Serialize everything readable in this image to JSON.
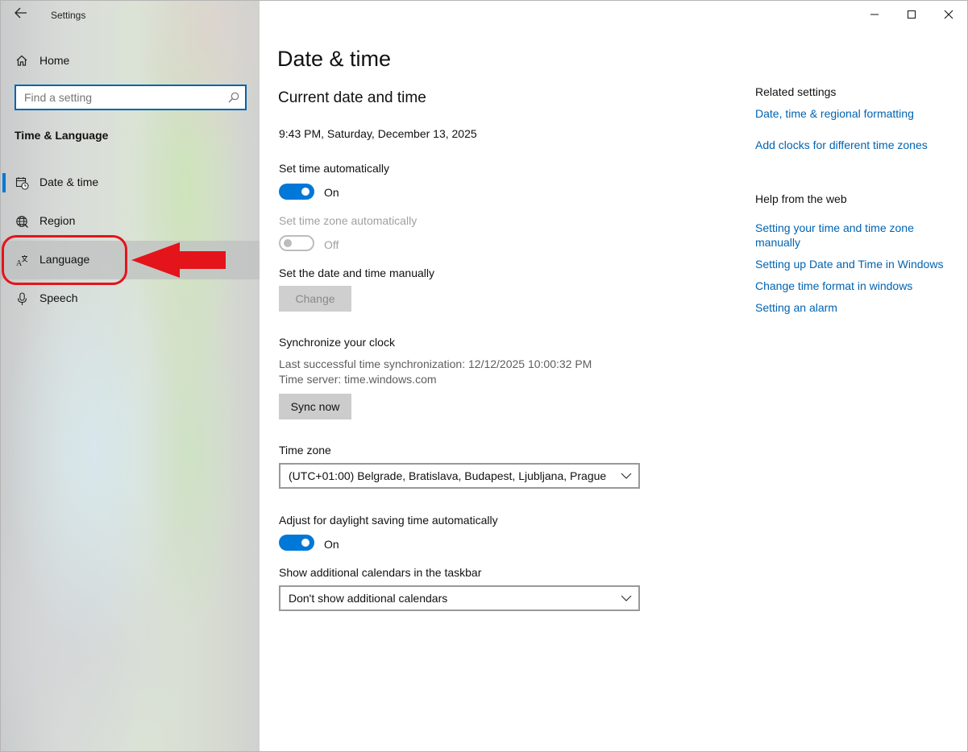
{
  "window": {
    "app_title": "Settings",
    "controls": [
      "minimize-icon",
      "maximize-icon",
      "close-icon"
    ]
  },
  "sidebar": {
    "home_label": "Home",
    "search_placeholder": "Find a setting",
    "section_title": "Time & Language",
    "items": [
      {
        "label": "Date & time",
        "icon": "date-time-icon",
        "selected": true
      },
      {
        "label": "Region",
        "icon": "globe-icon",
        "selected": false
      },
      {
        "label": "Language",
        "icon": "language-icon",
        "selected": false,
        "hovered": true
      },
      {
        "label": "Speech",
        "icon": "microphone-icon",
        "selected": false
      }
    ]
  },
  "main": {
    "page_title": "Date & time",
    "section_title": "Current date and time",
    "current_datetime": "9:43 PM, Saturday, December 13, 2025",
    "set_time_auto": {
      "label": "Set time automatically",
      "state": "On",
      "on": true
    },
    "set_tz_auto": {
      "label": "Set time zone automatically",
      "state": "Off",
      "on": false,
      "disabled": true
    },
    "manual": {
      "label": "Set the date and time manually",
      "button": "Change"
    },
    "sync": {
      "title": "Synchronize your clock",
      "last_sync": "Last successful time synchronization: 12/12/2025 10:00:32 PM",
      "server": "Time server: time.windows.com",
      "button": "Sync now"
    },
    "timezone": {
      "label": "Time zone",
      "value": "(UTC+01:00) Belgrade, Bratislava, Budapest, Ljubljana, Prague"
    },
    "dst": {
      "label": "Adjust for daylight saving time automatically",
      "state": "On",
      "on": true
    },
    "calendars": {
      "label": "Show additional calendars in the taskbar",
      "value": "Don't show additional calendars"
    }
  },
  "related": {
    "title": "Related settings",
    "links": [
      "Date, time & regional formatting",
      "Add clocks for different time zones"
    ]
  },
  "help": {
    "title": "Help from the web",
    "links": [
      "Setting your time and time zone manually",
      "Setting up Date and Time in Windows",
      "Change time format in windows",
      "Setting an alarm"
    ]
  },
  "colors": {
    "accent": "#0078d7",
    "link": "#0063b1",
    "annotation": "#e4141b"
  }
}
